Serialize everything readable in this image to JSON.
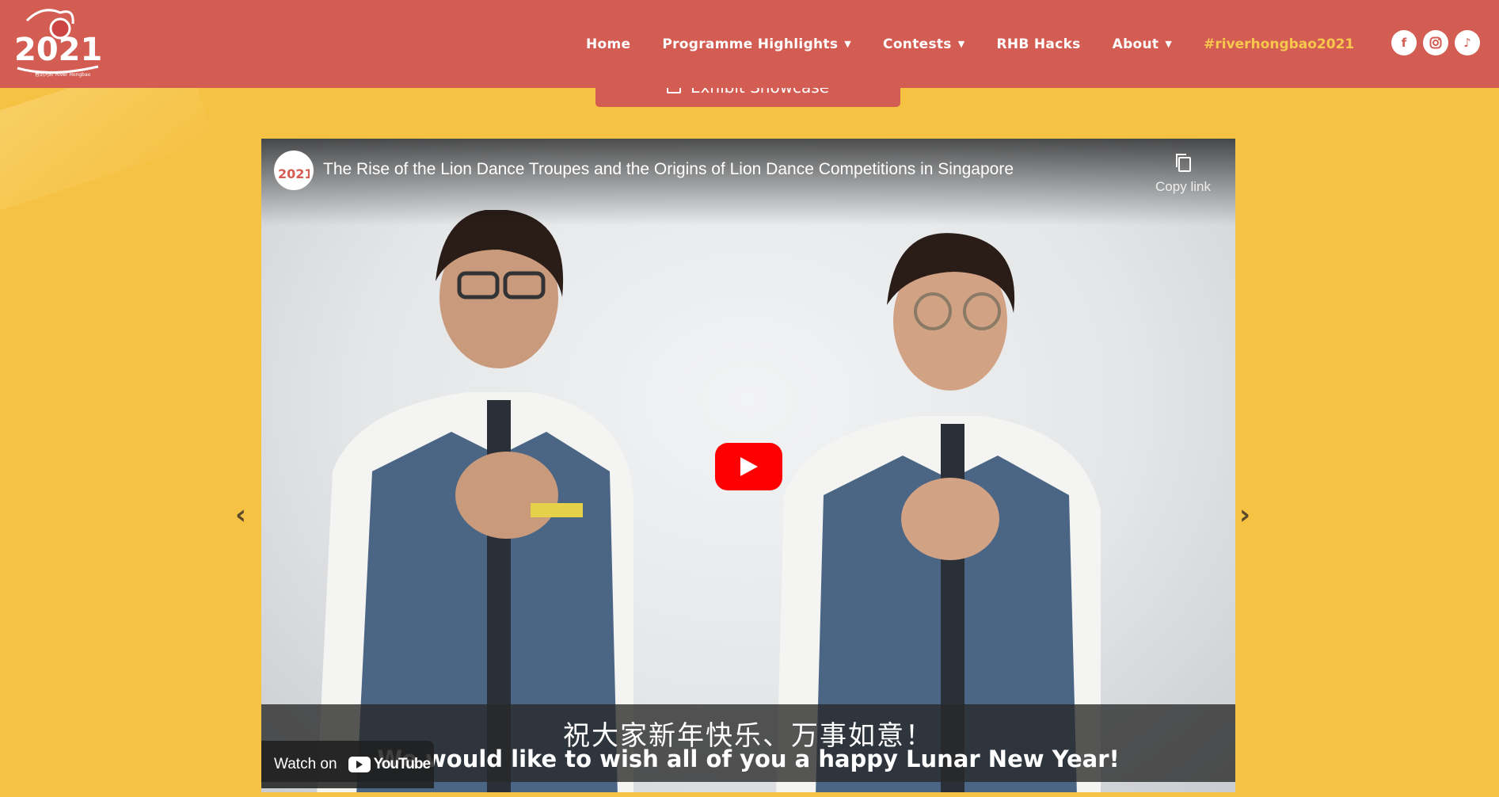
{
  "header": {
    "logo_year": "2021",
    "logo_caption": "春到河畔 River Hongbao",
    "nav": [
      {
        "label": "Home",
        "has_dropdown": false
      },
      {
        "label": "Programme Highlights",
        "has_dropdown": true
      },
      {
        "label": "Contests",
        "has_dropdown": true
      },
      {
        "label": "RHB Hacks",
        "has_dropdown": false
      },
      {
        "label": "About",
        "has_dropdown": true
      }
    ],
    "hashtag": "#riverhongbao2021",
    "socials": [
      "facebook-icon",
      "instagram-icon",
      "tiktok-icon"
    ],
    "bg_color": "#d35d53"
  },
  "exhibit_tab": {
    "label": "Exhibit Showcase"
  },
  "video": {
    "title": "The Rise of the Lion Dance Troupes and the Origins of Lion Dance Competitions in Singapore",
    "copy_link_label": "Copy link",
    "subtitle_cn": "祝大家新年快乐、万事如意！",
    "subtitle_en": "We would like to wish all of you a happy Lunar New Year!",
    "watch_on_label": "Watch on",
    "youtube_label": "YouTube"
  },
  "carousel": {
    "prev_icon": "chevron-left-icon",
    "next_icon": "chevron-right-icon"
  },
  "colors": {
    "page_bg": "#f5c244",
    "accent": "#d35d53",
    "hashtag": "#f7c84c",
    "play": "#ff0000"
  }
}
